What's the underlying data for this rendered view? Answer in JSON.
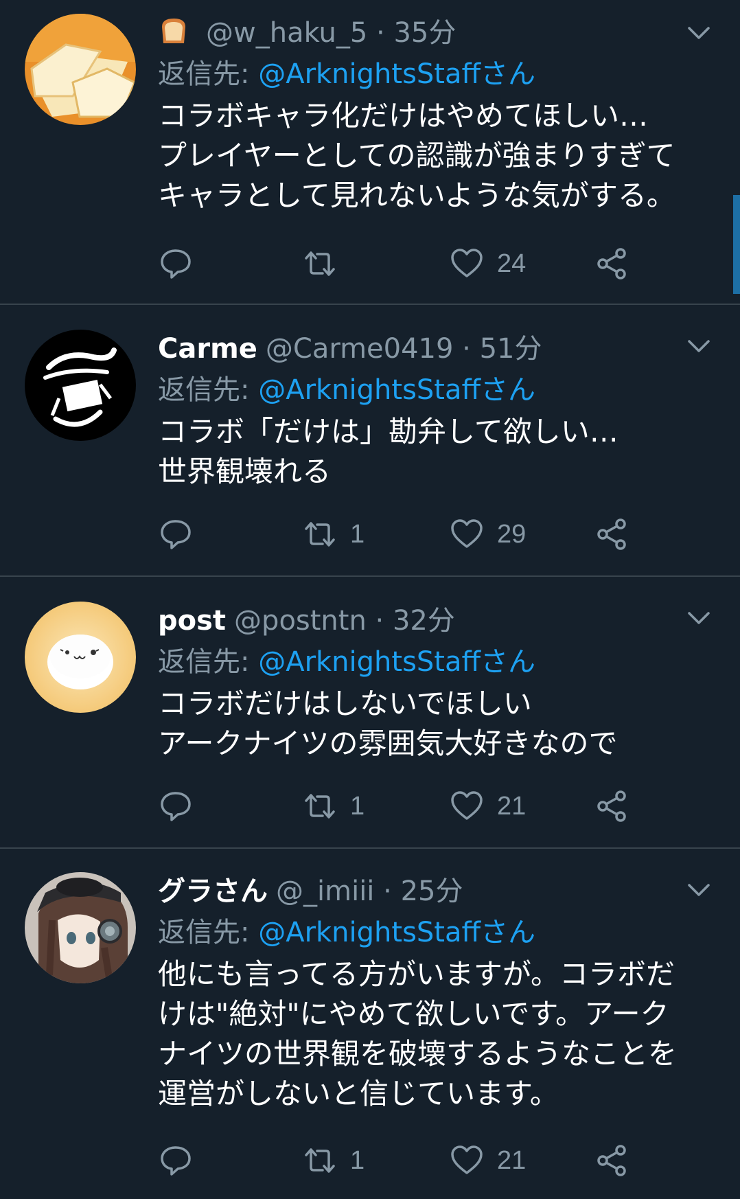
{
  "tweets": [
    {
      "display_name": "",
      "handle": "@w_haku_5",
      "time": "· 35分",
      "reply_label": "返信先: ",
      "reply_mention": "@ArknightsStaffさん",
      "text": "コラボキャラ化だけはやめてほしい…\nプレイヤーとしての認識が強まりすぎて\nキャラとして見れないような気がする。",
      "reply_count": "",
      "retweet_count": "",
      "like_count": "24",
      "name_icon": "bread-icon"
    },
    {
      "display_name": "Carme",
      "handle": "@Carme0419",
      "time": "· 51分",
      "reply_label": "返信先: ",
      "reply_mention": "@ArknightsStaffさん",
      "text": "コラボ「だけは」勘弁して欲しい…\n世界観壊れる",
      "reply_count": "",
      "retweet_count": "1",
      "like_count": "29"
    },
    {
      "display_name": "post",
      "handle": "@postntn",
      "time": "· 32分",
      "reply_label": "返信先: ",
      "reply_mention": "@ArknightsStaffさん",
      "text": "コラボだけはしないでほしい\nアークナイツの雰囲気大好きなので",
      "reply_count": "",
      "retweet_count": "1",
      "like_count": "21"
    },
    {
      "display_name": "グラさん",
      "handle": "@_imiii",
      "time": "· 25分",
      "reply_label": "返信先: ",
      "reply_mention": "@ArknightsStaffさん",
      "text": "他にも言ってる方がいますが。コラボだ\nけは\"絶対\"にやめて欲しいです。アーク\nナイツの世界観を破壊するようなことを\n運営がしないと信じています。",
      "reply_count": "",
      "retweet_count": "1",
      "like_count": "21"
    }
  ],
  "colors": {
    "background": "#15202b",
    "divider": "#38444d",
    "secondary_text": "#8899a6",
    "mention": "#1da1f2"
  }
}
